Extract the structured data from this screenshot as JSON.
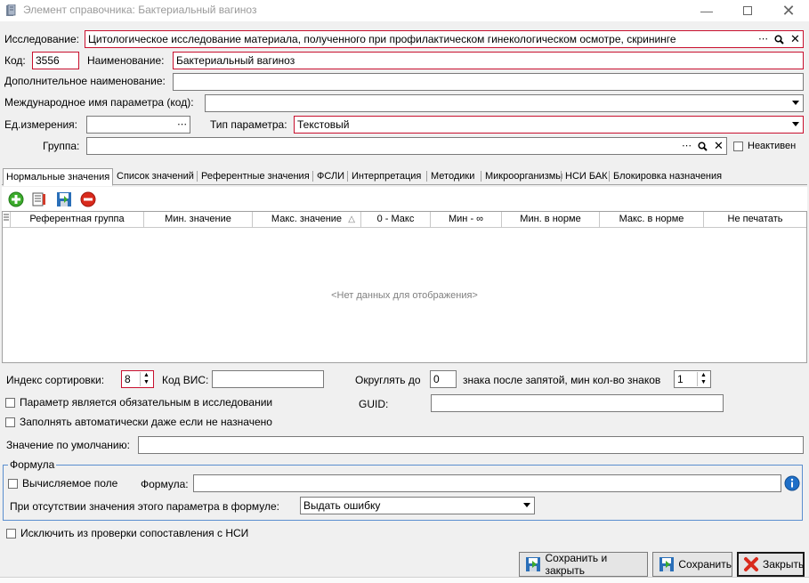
{
  "window": {
    "title": "Элемент справочника: Бактериальный вагиноз"
  },
  "form": {
    "study_label": "Исследование:",
    "study_value": "Цитологическое исследование материала, полученного при профилактическом гинекологическом осмотре, скрининге",
    "code_label": "Код:",
    "code_value": "3556",
    "name_label": "Наименование:",
    "name_value": "Бактериальный вагиноз",
    "additional_name_label": "Дополнительное наименование:",
    "additional_name_value": "",
    "intl_name_label": "Международное имя параметра (код):",
    "intl_name_value": "",
    "unit_label": "Ед.измерения:",
    "unit_value": "",
    "param_type_label": "Тип параметра:",
    "param_type_value": "Текстовый",
    "group_label": "Группа:",
    "group_value": "",
    "inactive_label": "Неактивен"
  },
  "tabs": [
    {
      "label": "Нормальные значения",
      "active": true
    },
    {
      "label": "Список значений"
    },
    {
      "label": "Референтные значения"
    },
    {
      "label": "ФСЛИ"
    },
    {
      "label": "Интерпретация"
    },
    {
      "label": "Методики"
    },
    {
      "label": "Микроорганизмы"
    },
    {
      "label": "НСИ БАК"
    },
    {
      "label": "Блокировка назначения"
    }
  ],
  "toolbar": {
    "icons": [
      "add-icon",
      "edit-icon",
      "save-icon",
      "delete-icon"
    ]
  },
  "grid": {
    "columns": [
      "Референтная группа",
      "Мин. значение",
      "Макс. значение",
      "0 - Макс",
      "Мин - ∞",
      "Мин. в норме",
      "Макс. в норме",
      "Не печатать"
    ],
    "sort_glyph": "△",
    "empty_text": "<Нет данных для отображения>"
  },
  "bottom": {
    "sort_index_label": "Индекс сортировки:",
    "sort_index_value": "8",
    "vis_code_label": "Код ВИС:",
    "vis_code_value": "",
    "round_label": "Округлять до",
    "round_value": "0",
    "decimals_label": "знака после запятой, мин кол-во знаков",
    "min_digits_value": "1",
    "mandatory_label": "Параметр является обязательным в исследовании",
    "autofill_label": "Заполнять автоматически даже если не назначено",
    "guid_label": "GUID:",
    "guid_value": "",
    "default_label": "Значение по умолчанию:",
    "default_value": ""
  },
  "formula": {
    "legend": "Формула",
    "computed_label": "Вычисляемое поле",
    "formula_label": "Формула:",
    "formula_value": "",
    "missing_label": "При отсутствии значения этого параметра в формуле:",
    "missing_value": "Выдать ошибку"
  },
  "exclude_nsi_label": "Исключить из проверки сопоставления с НСИ",
  "buttons": {
    "save_close": "Сохранить и закрыть",
    "save": "Сохранить",
    "close": "Закрыть"
  },
  "colors": {
    "required_border": "#c8102e",
    "group_border": "#5a8ecf",
    "info_blue": "#1e6fc8"
  }
}
